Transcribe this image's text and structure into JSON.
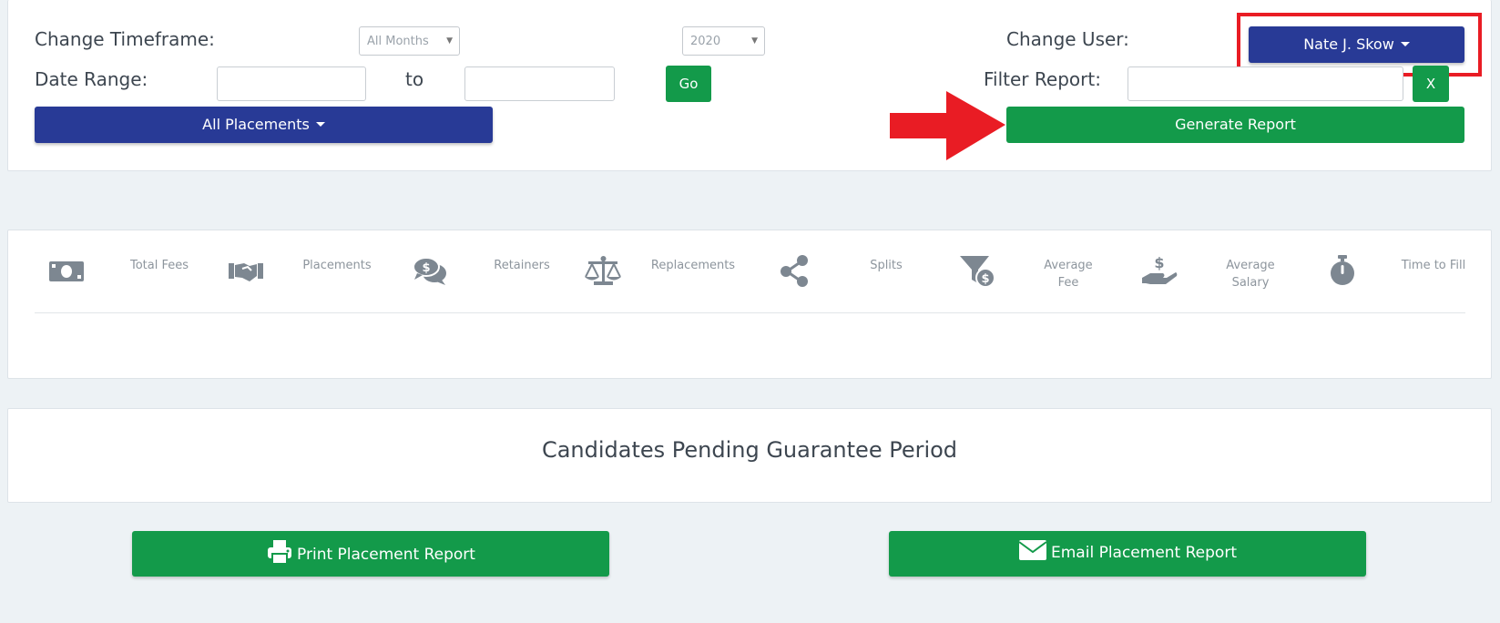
{
  "filters": {
    "timeframe_label": "Change Timeframe:",
    "month_select_value": "All Months",
    "year_select_value": "2020",
    "date_range_label": "Date Range:",
    "to_label": "to",
    "start_date_value": "",
    "end_date_value": "",
    "go_label": "Go",
    "placements_dropdown_label": "All Placements"
  },
  "user": {
    "change_user_label": "Change User:",
    "user_dropdown_label": "Nate J. Skow",
    "filter_report_label": "Filter Report:",
    "filter_report_value": "",
    "clear_filter_label": "X",
    "generate_report_label": "Generate Report"
  },
  "stats": [
    {
      "icon": "money-bill-icon",
      "label": "Total Fees"
    },
    {
      "icon": "handshake-icon",
      "label": "Placements"
    },
    {
      "icon": "comments-dollar-icon",
      "label": "Retainers"
    },
    {
      "icon": "balance-scale-icon",
      "label": "Replacements"
    },
    {
      "icon": "share-alt-icon",
      "label": "Splits"
    },
    {
      "icon": "funnel-dollar-icon",
      "label": "Average Fee"
    },
    {
      "icon": "hand-holding-usd-icon",
      "label": "Average Salary"
    },
    {
      "icon": "stopwatch-icon",
      "label": "Time to Fill"
    }
  ],
  "pending": {
    "title": "Candidates Pending Guarantee Period"
  },
  "actions": {
    "print_label": "Print Placement Report",
    "email_label": "Email Placement Report"
  },
  "colors": {
    "primary_blue": "#283a96",
    "green": "#139a4a",
    "annotation_red": "#e91c24",
    "icon_gray": "#7d8791"
  }
}
